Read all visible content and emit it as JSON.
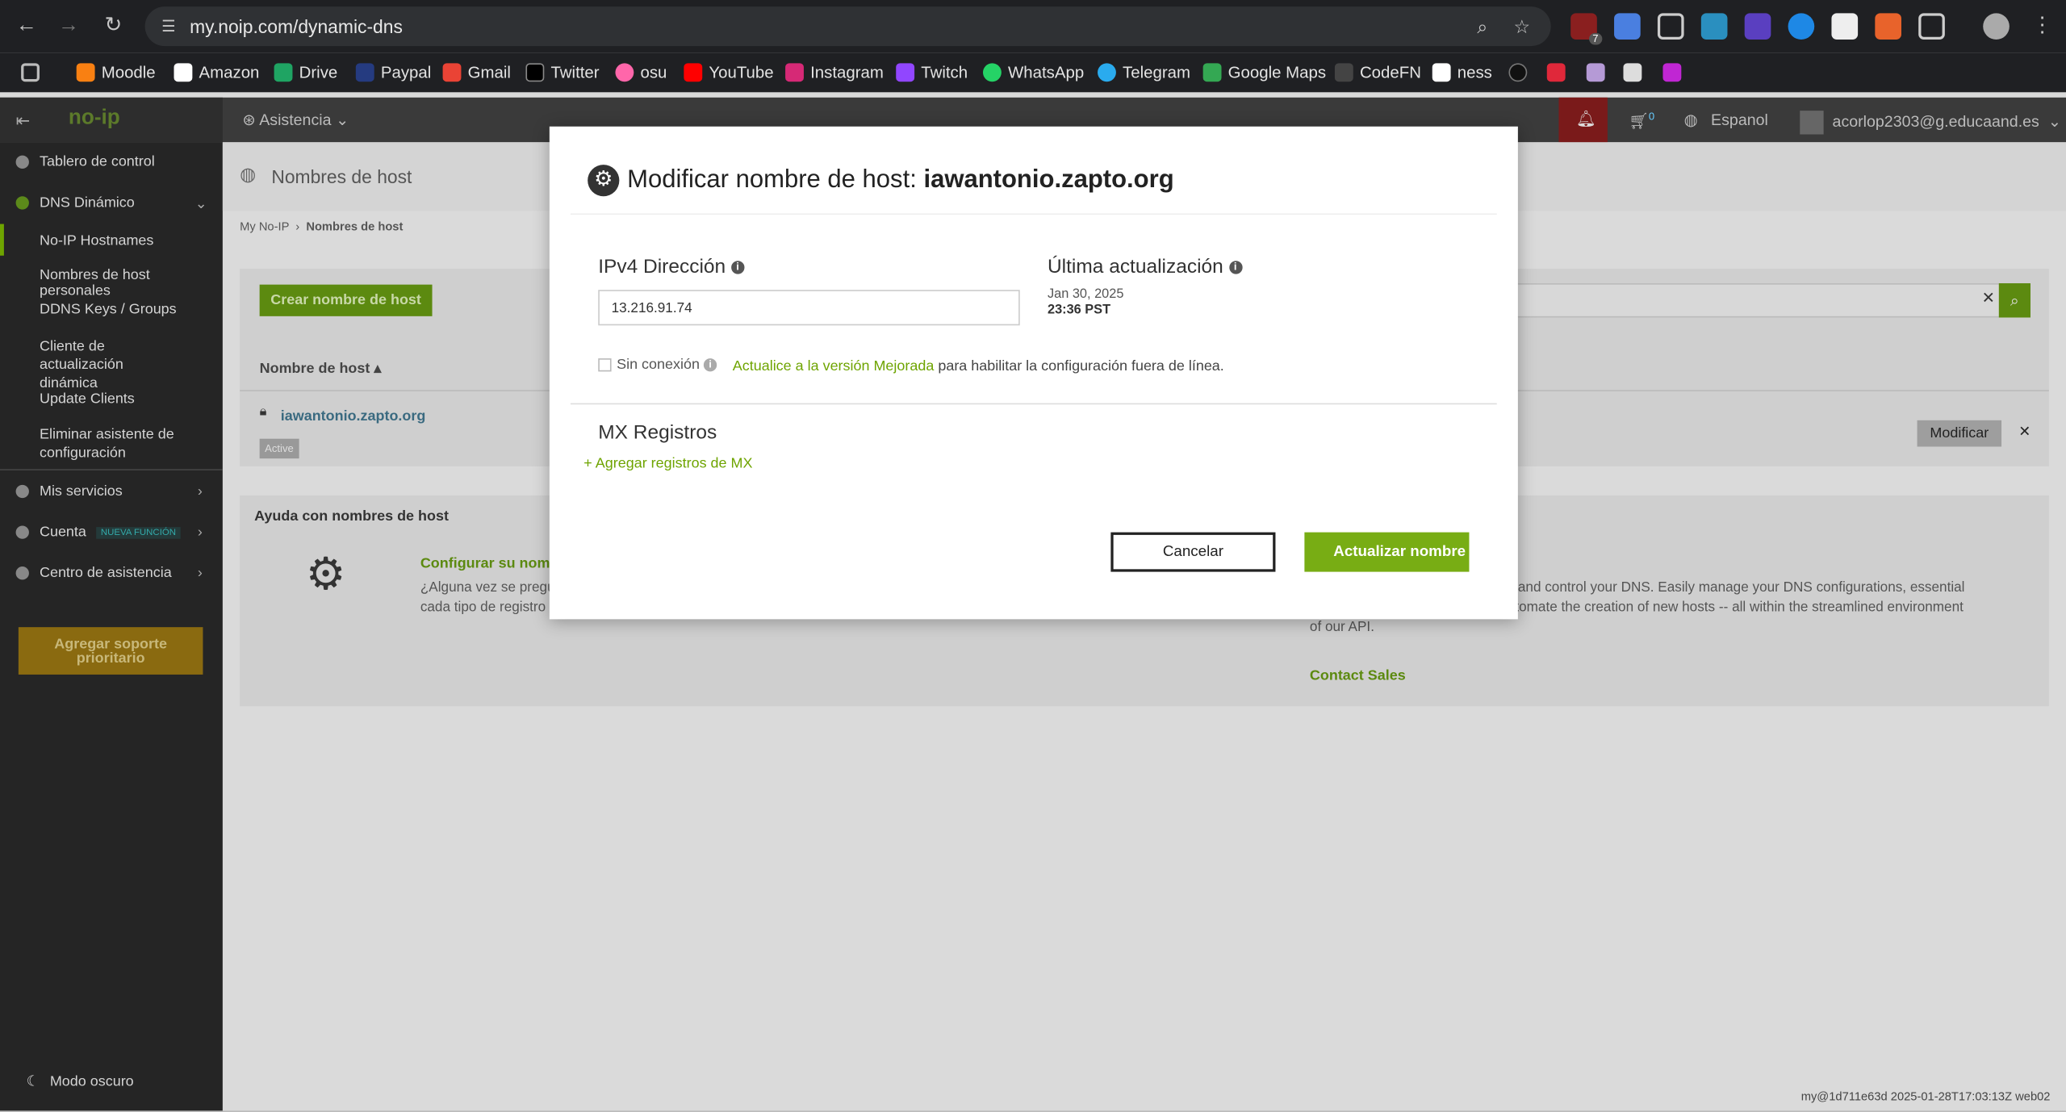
{
  "browser": {
    "url": "my.noip.com/dynamic-dns",
    "bookmarks": [
      "Moodle",
      "Amazon",
      "Drive",
      "Paypal",
      "Gmail",
      "Twitter",
      "osu",
      "YouTube",
      "Instagram",
      "Twitch",
      "WhatsApp",
      "Telegram",
      "Google Maps",
      "CodeFN",
      "ness"
    ],
    "ext_badge": "7"
  },
  "header": {
    "logo": "no-ip",
    "assist": "Asistencia",
    "cart_count": "0",
    "language": "Espanol",
    "user": "acorlop2303@g.educaand.es"
  },
  "sidebar": {
    "dashboard": "Tablero de control",
    "dns": "DNS Dinámico",
    "items": [
      "No-IP Hostnames",
      "Nombres de host personales",
      "DDNS Keys / Groups",
      "Cliente de actualización dinámica",
      "Update Clients",
      "Eliminar asistente de configuración"
    ],
    "services": "Mis servicios",
    "account": "Cuenta",
    "new_feature": "NUEVA FUNCIÓN",
    "help_center": "Centro de asistencia",
    "priority_button": "Agregar soporte prioritario",
    "dark_mode": "Modo oscuro"
  },
  "main": {
    "page_title": "Nombres de host",
    "breadcrumb_root": "My No-IP",
    "breadcrumb_current": "Nombres de host",
    "create_button": "Crear nombre de host",
    "col_hostname": "Nombre de host",
    "host": "iawantonio.zapto.org",
    "status": "Active",
    "modify_button": "Modificar",
    "help_title": "Ayuda con nombres de host",
    "help_link": "Configurar su nomb",
    "help_text_1": "¿Alguna vez se pregu",
    "help_text_2": "cada tipo de registro",
    "right_text_1": "and control your DNS. Easily manage your DNS configurations, essential",
    "right_text_2": "y automate the creation of new hosts -- all within the streamlined environment",
    "right_text_3": "of our API.",
    "contact_sales": "Contact Sales",
    "footer": "my@1d711e63d 2025-01-28T17:03:13Z web02"
  },
  "modal": {
    "title_prefix": "Modificar nombre de host",
    "title_host": "iawantonio.zapto.org",
    "ipv4_label": "IPv4 Dirección",
    "ipv4_value": "13.216.91.74",
    "last_update_label": "Última actualización",
    "last_update_date": "Jan 30, 2025",
    "last_update_time": "23:36 PST",
    "offline_label": "Sin conexión",
    "upgrade_link": "Actualice a la versión Mejorada",
    "upgrade_text": "para habilitar la configuración fuera de línea.",
    "mx_title": "MX Registros",
    "mx_add": "Agregar registros de MX",
    "cancel": "Cancelar",
    "update": "Actualizar nombre de host"
  }
}
